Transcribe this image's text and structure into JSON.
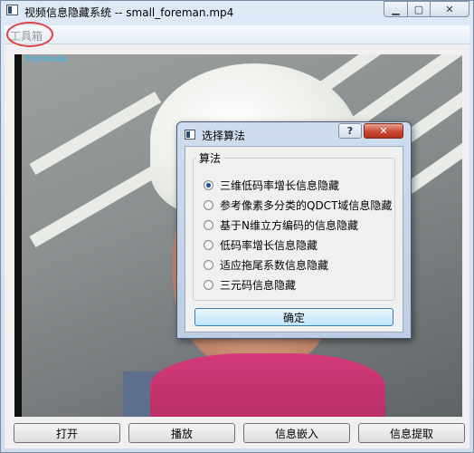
{
  "window": {
    "title": "视频信息隐藏系统 -- small_foreman.mp4",
    "minimize": "▁",
    "maximize": "▢",
    "close": "✕"
  },
  "menu": {
    "toolbox": "工具箱"
  },
  "video": {
    "overlay_text": "Formula"
  },
  "buttons": {
    "open": "打开",
    "play": "播放",
    "embed": "信息嵌入",
    "extract": "信息提取"
  },
  "dialog": {
    "title": "选择算法",
    "help": "?",
    "close": "✕",
    "group_label": "算法",
    "options": [
      {
        "label": "三维低码率增长信息隐藏",
        "selected": true
      },
      {
        "label": "参考像素多分类的QDCT域信息隐藏",
        "selected": false
      },
      {
        "label": "基于N维立方编码的信息隐藏",
        "selected": false
      },
      {
        "label": "低码率增长信息隐藏",
        "selected": false
      },
      {
        "label": "适应拖尾系数信息隐藏",
        "selected": false
      },
      {
        "label": "三元码信息隐藏",
        "selected": false
      }
    ],
    "ok": "确定"
  }
}
